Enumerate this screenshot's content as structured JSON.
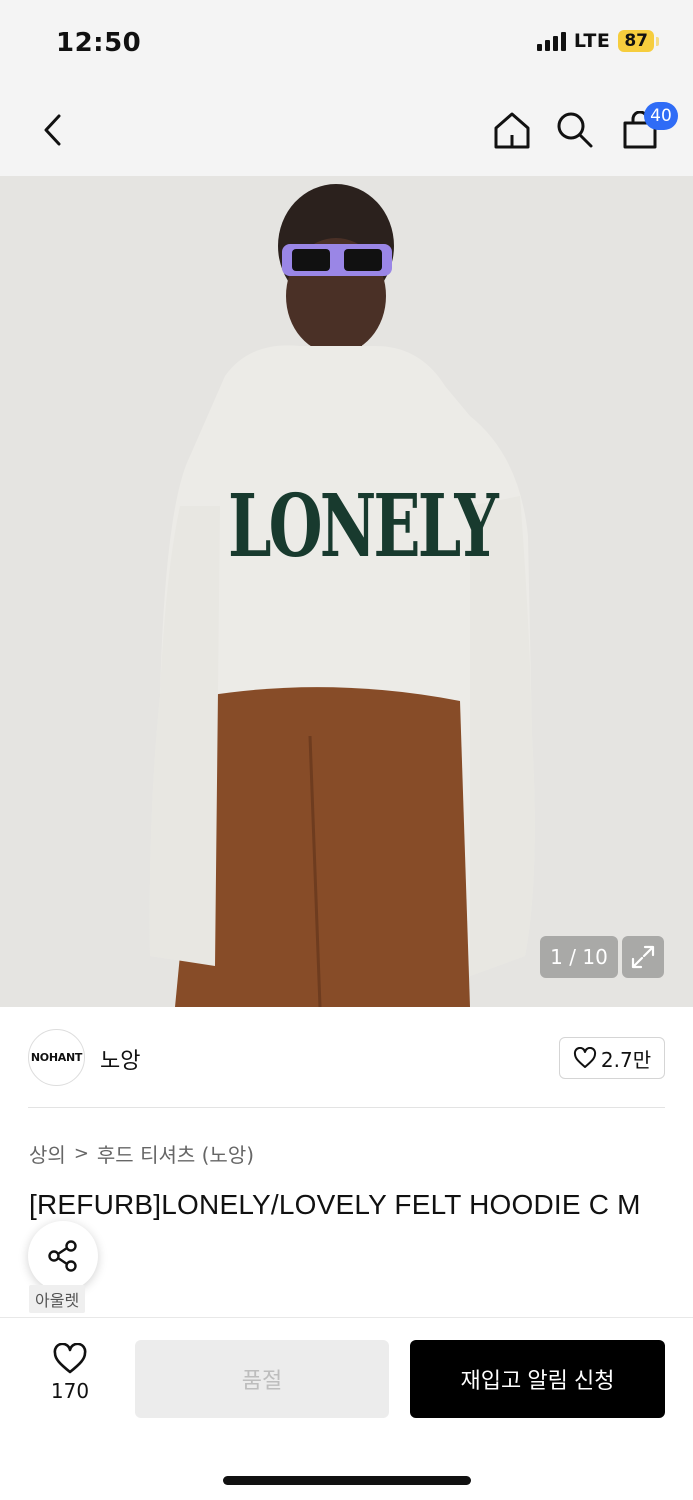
{
  "status": {
    "time": "12:50",
    "network": "LTE",
    "battery": "87"
  },
  "nav": {
    "cart_count": "40"
  },
  "gallery": {
    "counter": "1 / 10",
    "print_text": "LONELY"
  },
  "brand": {
    "logo_text": "NOHANT",
    "name": "노앙",
    "likes": "2.7만"
  },
  "breadcrumb": {
    "level1": "상의",
    "separator": ">",
    "level2": "후드 티셔츠 (노앙)"
  },
  "product": {
    "title": "[REFURB]LONELY/LOVELY FELT HOODIE C    M",
    "tag": "아울렛"
  },
  "actions": {
    "wish_count": "170",
    "soldout_label": "품절",
    "restock_label": "재입고 알림 신청"
  },
  "colors": {
    "accent_badge": "#2f6cf6",
    "battery": "#f6cd3d",
    "primary_button": "#000000"
  }
}
